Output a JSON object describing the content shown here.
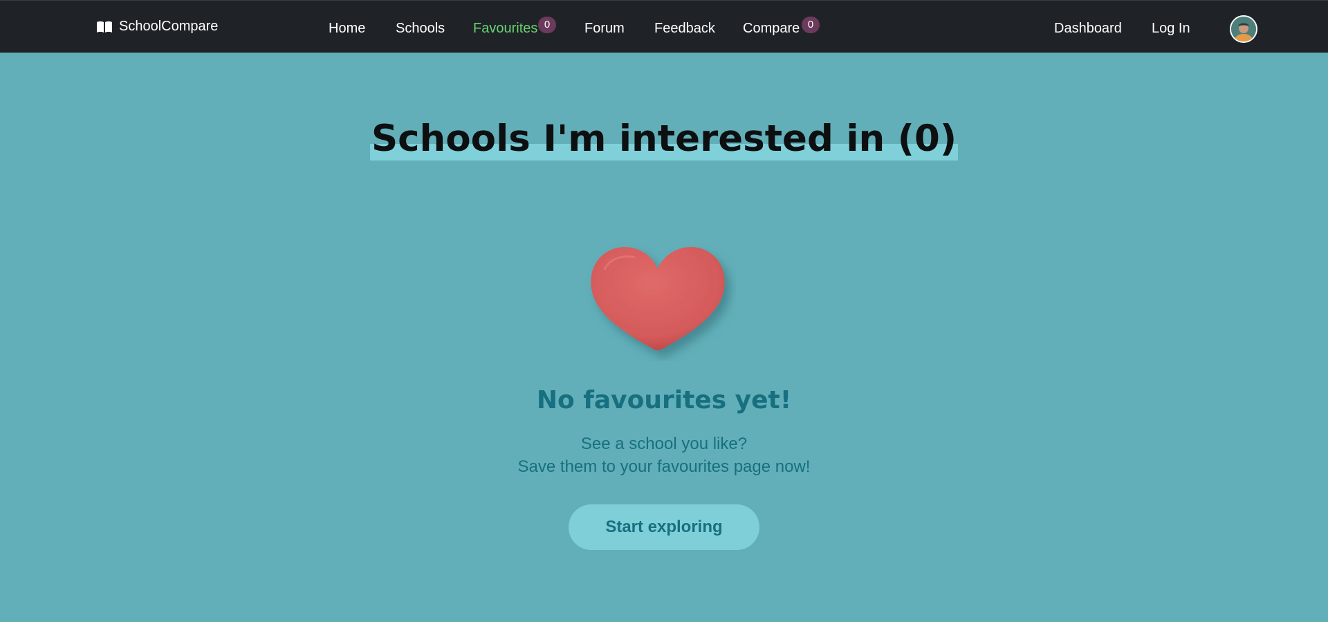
{
  "nav": {
    "brand": "SchoolCompare",
    "links": {
      "home": "Home",
      "schools": "Schools",
      "favourites": "Favourites",
      "forum": "Forum",
      "feedback": "Feedback",
      "compare": "Compare",
      "dashboard": "Dashboard",
      "login": "Log In"
    },
    "badges": {
      "favourites": "0",
      "compare": "0"
    },
    "active_link": "Favourites",
    "active_color": "#69d36f"
  },
  "main": {
    "title": "Schools I'm interested in (0)",
    "empty_title": "No favourites yet!",
    "empty_line1": "See a school you like?",
    "empty_line2": "Save them to your favourites page now!",
    "cta_label": "Start exploring"
  },
  "icons": {
    "brand": "open-book-icon",
    "illustration": "heart-icon",
    "avatar": "user-avatar"
  },
  "colors": {
    "background": "#62afb9",
    "navbar": "#1f2328",
    "heart": "#d95f5f",
    "accent_text": "#176f80",
    "badge": "#6b3a5c"
  }
}
